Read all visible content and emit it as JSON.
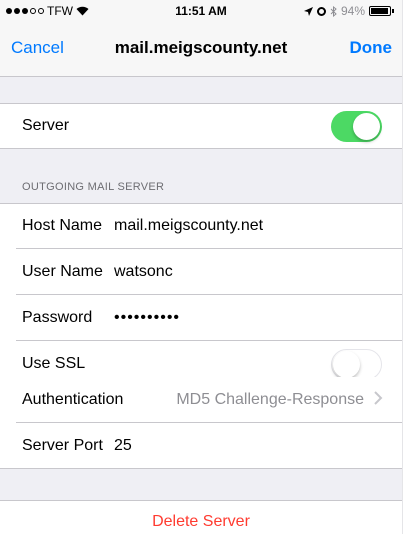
{
  "status_bar": {
    "carrier": "TFW",
    "time": "11:51 AM",
    "battery": "94%",
    "battery_level": 0.94
  },
  "nav": {
    "cancel_label": "Cancel",
    "title": "mail.meigscounty.net",
    "done_label": "Done"
  },
  "server": {
    "label": "Server",
    "enabled": true
  },
  "outgoing": {
    "header": "OUTGOING MAIL SERVER",
    "host_label": "Host Name",
    "host_value": "mail.meigscounty.net",
    "user_label": "User Name",
    "user_value": "watsonc",
    "password_label": "Password",
    "password_value": "••••••••••",
    "ssl_label": "Use SSL",
    "ssl_enabled": false,
    "auth_label": "Authentication",
    "auth_value": "MD5 Challenge-Response",
    "port_label": "Server Port",
    "port_value": "25"
  },
  "actions": {
    "delete_label": "Delete Server"
  },
  "colors": {
    "accent": "#007aff",
    "toggle_on": "#4cd964",
    "destructive": "#ff3b30",
    "background": "#efeff4"
  }
}
